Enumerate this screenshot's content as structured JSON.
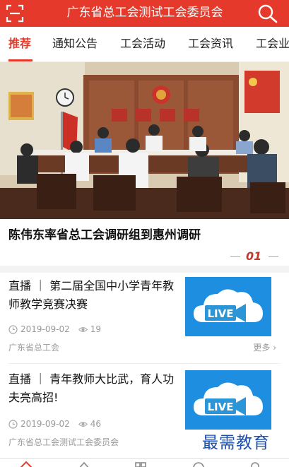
{
  "header": {
    "title": "广东省总工会测试工会委员会",
    "left_icon": "scan-icon",
    "right_icon": "search-icon",
    "bg_color": "#e53a2b"
  },
  "tabs": [
    {
      "label": "推荐",
      "active": true
    },
    {
      "label": "通知公告",
      "active": false
    },
    {
      "label": "工会活动",
      "active": false
    },
    {
      "label": "工会资讯",
      "active": false
    },
    {
      "label": "工会业",
      "active": false
    }
  ],
  "banner": {
    "image": "meeting-room-photo",
    "headline": "陈伟东率省总工会调研组到惠州调研",
    "index": "01"
  },
  "news": [
    {
      "title": "直播 ｜ 第二届全国中小学青年教师教学竞赛决赛",
      "date": "2019-09-02",
      "views": "19",
      "source": "广东省总工会",
      "more": "更多",
      "thumb_label": "LIVE"
    },
    {
      "title": "直播 ｜ 青年教师大比武，育人功夫亮高招!",
      "date": "2019-09-02",
      "views": "46",
      "source": "广东省总工会测试工会委员会",
      "thumb_label": "LIVE"
    }
  ],
  "watermark": "最需教育",
  "colors": {
    "accent": "#e53a2b",
    "live_blue": "#1e8fe0",
    "index_red": "#c0392b"
  }
}
